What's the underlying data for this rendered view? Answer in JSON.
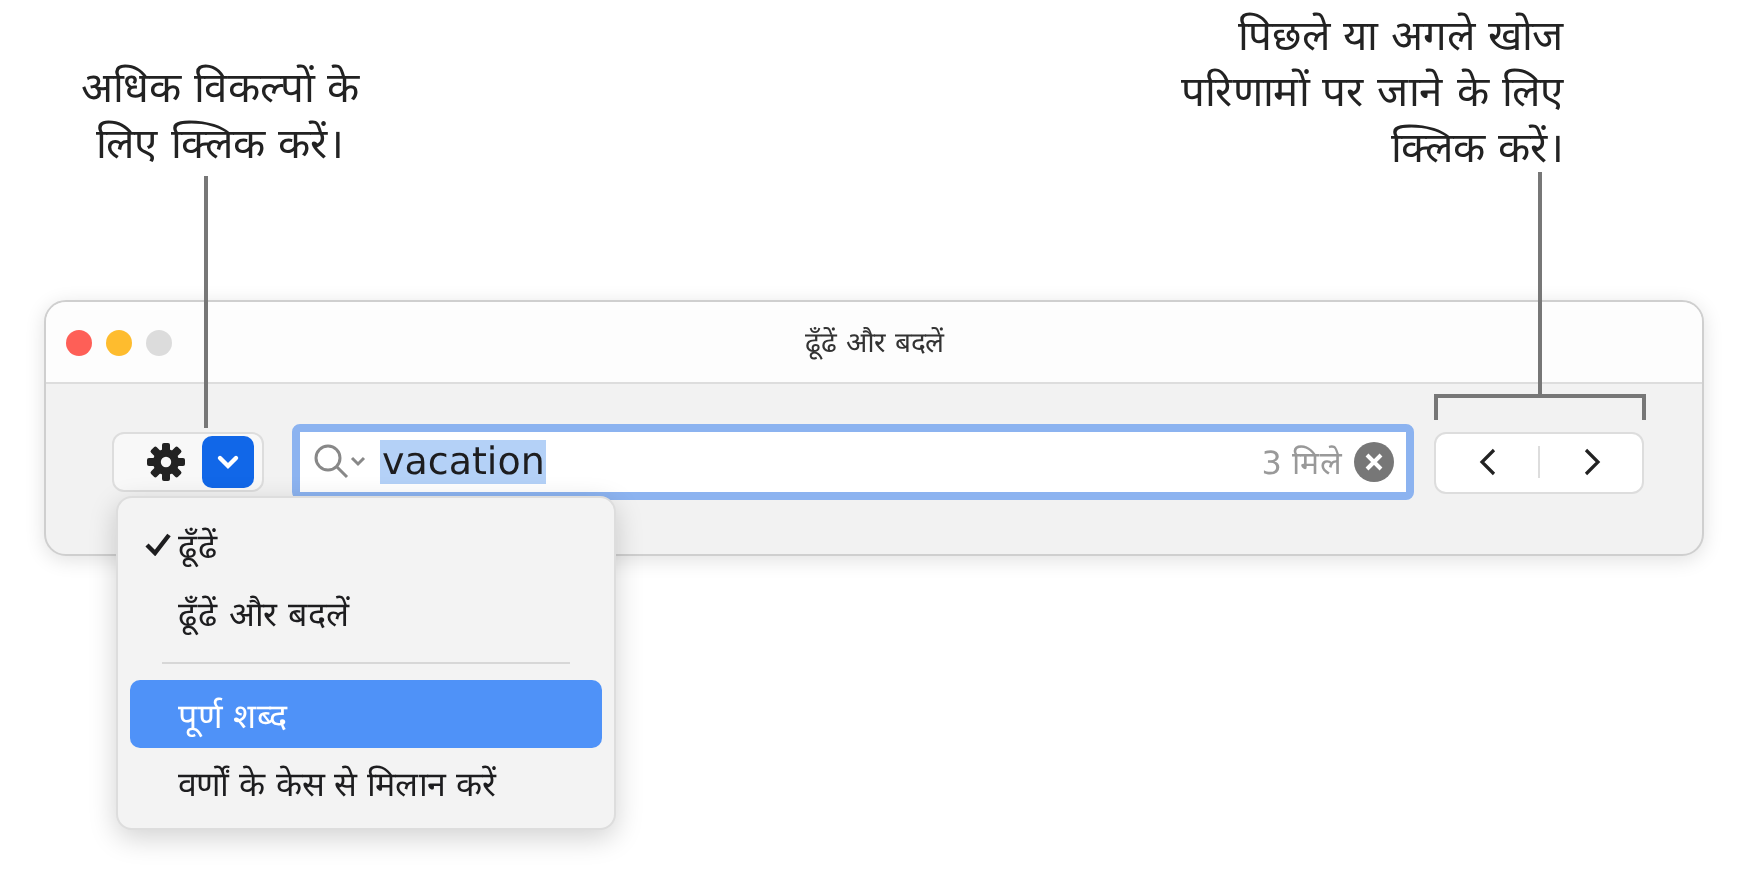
{
  "callouts": [
    {
      "text": "अधिक विकल्पों के\nलिए क्लिक करें।",
      "kind": "top"
    },
    {
      "text": "पिछले या अगले खोज\nपरिणामों पर जाने के लिए\nक्लिक करें।",
      "kind": "side"
    }
  ],
  "window": {
    "title": "ढूँढें और बदलें"
  },
  "search": {
    "value": "vacation",
    "match_count": "3 मिले"
  },
  "menu": {
    "items": [
      {
        "kind": "item",
        "label": "ढूँढें",
        "checked": true,
        "selected": false
      },
      {
        "kind": "item",
        "label": "ढूँढें और बदलें",
        "checked": false,
        "selected": false
      },
      {
        "kind": "separator"
      },
      {
        "kind": "item",
        "label": "पूर्ण शब्द",
        "checked": false,
        "selected": true
      },
      {
        "kind": "item",
        "label": "वर्णों के केस से मिलान करें",
        "checked": false,
        "selected": false
      }
    ]
  }
}
